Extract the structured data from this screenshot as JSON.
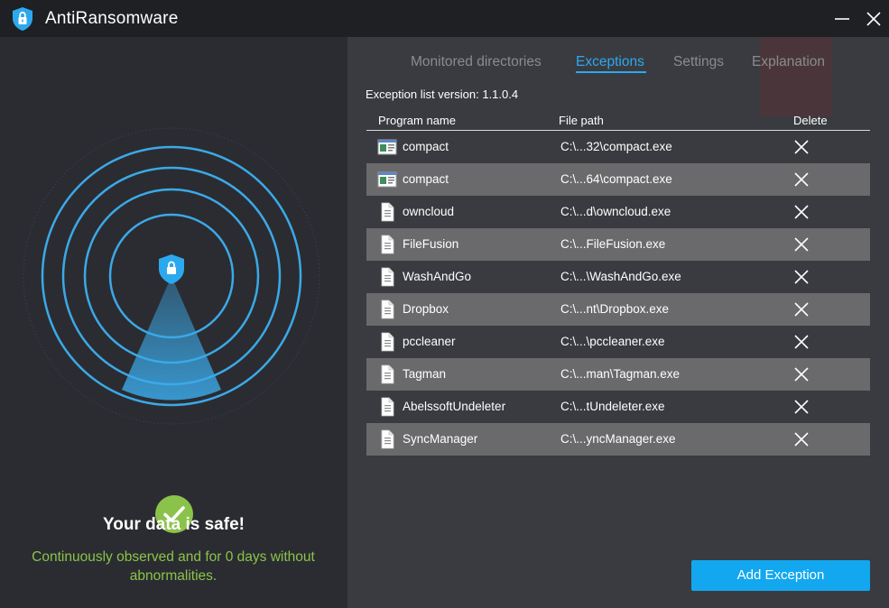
{
  "app": {
    "title": "AntiRansomware"
  },
  "status": {
    "title": "Your data is safe!",
    "subtitle": "Continuously observed and for 0 days without abnormalities."
  },
  "tabs": [
    {
      "label": "Monitored directories",
      "active": false
    },
    {
      "label": "Exceptions",
      "active": true
    },
    {
      "label": "Settings",
      "active": false
    },
    {
      "label": "Explanation",
      "active": false
    }
  ],
  "exceptions": {
    "version_label": "Exception list version: 1.1.0.4",
    "columns": {
      "name": "Program name",
      "path": "File path",
      "delete": "Delete"
    },
    "rows": [
      {
        "name": "compact",
        "path": "C:\\...32\\compact.exe",
        "icon": "program-window-icon"
      },
      {
        "name": "compact",
        "path": "C:\\...64\\compact.exe",
        "icon": "program-window-icon"
      },
      {
        "name": "owncloud",
        "path": "C:\\...d\\owncloud.exe",
        "icon": "file-icon"
      },
      {
        "name": "FileFusion",
        "path": "C:\\...FileFusion.exe",
        "icon": "file-icon"
      },
      {
        "name": "WashAndGo",
        "path": "C:\\...\\WashAndGo.exe",
        "icon": "file-icon"
      },
      {
        "name": "Dropbox",
        "path": "C:\\...nt\\Dropbox.exe",
        "icon": "file-icon"
      },
      {
        "name": "pccleaner",
        "path": "C:\\...\\pccleaner.exe",
        "icon": "file-icon"
      },
      {
        "name": "Tagman",
        "path": "C:\\...man\\Tagman.exe",
        "icon": "file-icon"
      },
      {
        "name": "AbelssoftUndeleter",
        "path": "C:\\...tUndeleter.exe",
        "icon": "file-icon"
      },
      {
        "name": "SyncManager",
        "path": "C:\\...yncManager.exe",
        "icon": "file-icon"
      }
    ],
    "add_button": "Add Exception"
  },
  "colors": {
    "accent": "#2ca9ee",
    "button": "#13a7f0",
    "safe_green": "#8bc34a",
    "radar_blue": "#3ba9e8"
  }
}
